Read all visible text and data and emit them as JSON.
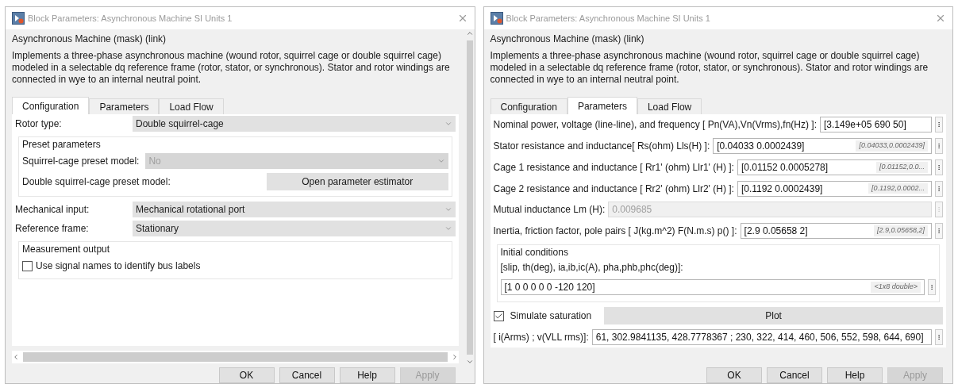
{
  "dialogs": [
    {
      "title": "Block Parameters: Asynchronous Machine SI Units 1",
      "header": "Asynchronous Machine (mask) (link)",
      "description": "Implements a three-phase asynchronous machine (wound rotor, squirrel cage or double squirrel cage) modeled in a selectable dq reference frame (rotor, stator, or synchronous). Stator and rotor windings are connected in wye to an internal neutral point.",
      "scrollable": true,
      "tabs": [
        {
          "label": "Configuration",
          "selected": true
        },
        {
          "label": "Parameters",
          "selected": false
        },
        {
          "label": "Load Flow",
          "selected": false
        }
      ],
      "rows": [
        {
          "kind": "dropdown",
          "label": "Rotor type:",
          "value": "Double squirrel-cage",
          "disabled": false
        },
        {
          "kind": "group",
          "title": "Preset parameters",
          "children": [
            {
              "kind": "dropdown",
              "label": "Squirrel-cage preset model:",
              "value": "No",
              "disabled": true
            },
            {
              "kind": "button",
              "label": "Double squirrel-cage preset model:",
              "button": "Open parameter estimator"
            }
          ]
        },
        {
          "kind": "dropdown",
          "label": "Mechanical input:",
          "value": "Mechanical rotational port",
          "disabled": false
        },
        {
          "kind": "dropdown",
          "label": "Reference frame:",
          "value": "Stationary",
          "disabled": false
        },
        {
          "kind": "group",
          "title": "Measurement output",
          "children": [
            {
              "kind": "checkbox",
              "label": "Use signal names to identify bus labels",
              "checked": false
            }
          ]
        }
      ],
      "buttons": [
        {
          "label": "OK",
          "disabled": false
        },
        {
          "label": "Cancel",
          "disabled": false
        },
        {
          "label": "Help",
          "disabled": false
        },
        {
          "label": "Apply",
          "disabled": true
        }
      ]
    },
    {
      "title": "Block Parameters: Asynchronous Machine SI Units 1",
      "header": "Asynchronous Machine (mask) (link)",
      "description": "Implements a three-phase asynchronous machine (wound rotor, squirrel cage or double squirrel cage) modeled in a selectable dq reference frame (rotor, stator, or synchronous). Stator and rotor windings are connected in wye to an internal neutral point.",
      "scrollable": false,
      "tabs": [
        {
          "label": "Configuration",
          "selected": false
        },
        {
          "label": "Parameters",
          "selected": true
        },
        {
          "label": "Load Flow",
          "selected": false
        }
      ],
      "rows": [
        {
          "kind": "param",
          "label": "Nominal power, voltage (line-line), and frequency [ Pn(VA),Vn(Vrms),fn(Hz) ]:",
          "value": "[3.149e+05 690 50]",
          "disabled": false
        },
        {
          "kind": "param",
          "label": "Stator resistance and inductance[ Rs(ohm)  Lls(H) ]:",
          "value": "[0.04033 0.0002439]",
          "hint": "[0.04033,0.0002439]",
          "disabled": false
        },
        {
          "kind": "param",
          "label": "Cage 1 resistance and inductance  [ Rr1' (ohm)  Llr1' (H) ]:",
          "value": "[0.01152 0.0005278]",
          "hint": "[0.01152,0.0...",
          "disabled": false
        },
        {
          "kind": "param",
          "label": "Cage 2 resistance and inductance  [ Rr2' (ohm)  Llr2' (H) ]:",
          "value": "[0.1192 0.0002439]",
          "hint": "[0.1192,0.0002...",
          "disabled": false
        },
        {
          "kind": "param",
          "label": "Mutual inductance Lm (H):",
          "value": "0.009685",
          "disabled": true
        },
        {
          "kind": "param",
          "label": "Inertia, friction factor, pole pairs [ J(kg.m^2)  F(N.m.s)   p() ]:",
          "value": "[2.9 0.05658 2]",
          "hint": "[2.9,0.05658,2]",
          "disabled": false
        },
        {
          "kind": "group",
          "title": "Initial conditions",
          "children": [
            {
              "kind": "caption",
              "text": "[slip, th(deg), ia,ib,ic(A), pha,phb,phc(deg)]:"
            },
            {
              "kind": "param",
              "value": "[1 0 0 0 0 0 -120 120]",
              "hint": "<1x8 double>",
              "disabled": false
            }
          ]
        },
        {
          "kind": "checkbox_button",
          "label": "Simulate saturation",
          "checked": true,
          "button": "Plot"
        },
        {
          "kind": "param",
          "label": "[ i(Arms) ; v(VLL rms)]:",
          "value": "61, 302.9841135, 428.7778367 ; 230, 322, 414, 460, 506, 552, 598, 644, 690]",
          "disabled": false
        }
      ],
      "buttons": [
        {
          "label": "OK",
          "disabled": false
        },
        {
          "label": "Cancel",
          "disabled": false
        },
        {
          "label": "Help",
          "disabled": false
        },
        {
          "label": "Apply",
          "disabled": true
        }
      ]
    }
  ]
}
